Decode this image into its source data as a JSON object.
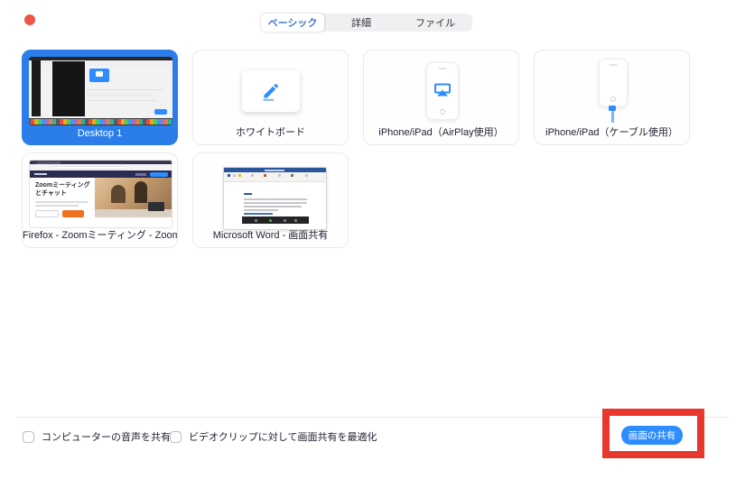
{
  "colors": {
    "accent_blue": "#2D8CFF",
    "selected_card_blue": "#2B7DE9",
    "annotation_red": "#E8382D",
    "tab_selected_text": "#4479C9",
    "word_title_blue": "#2B579A",
    "firefox_cta_orange": "#F0701E"
  },
  "tabs": [
    {
      "label": "ベーシック",
      "selected": true
    },
    {
      "label": "詳細",
      "selected": false
    },
    {
      "label": "ファイル",
      "selected": false
    }
  ],
  "tiles": [
    {
      "label": "Desktop 1",
      "selected": true
    },
    {
      "label": "ホワイトボード",
      "selected": false
    },
    {
      "label": "iPhone/iPad（AirPlay使用）",
      "selected": false
    },
    {
      "label": "iPhone/iPad（ケーブル使用）",
      "selected": false
    },
    {
      "label": "Firefox - Zoomミーティング - Zoom...",
      "selected": false,
      "thumb_heading": "Zoomミーティングとチャット"
    },
    {
      "label": "Microsoft Word - 画面共有",
      "selected": false
    }
  ],
  "footer": {
    "checkboxes": [
      {
        "label": "コンピューターの音声を共有",
        "checked": false
      },
      {
        "label": "ビデオクリップに対して画面共有を最適化",
        "checked": false
      }
    ],
    "share_button_label": "画面の共有"
  }
}
